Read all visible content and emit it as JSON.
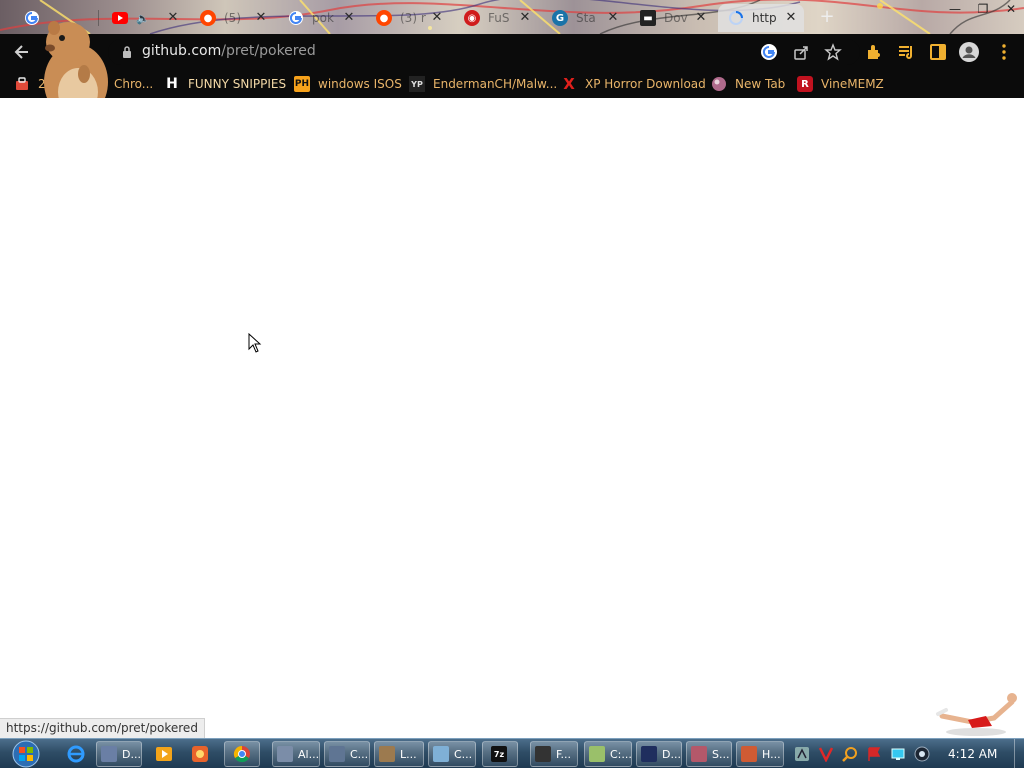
{
  "browser": {
    "tabs": [
      {
        "title": "",
        "favicon": "google-icon"
      },
      {
        "title": "",
        "favicon": "youtube-icon"
      },
      {
        "title": "(5)",
        "favicon": "reddit-icon"
      },
      {
        "title": "pok",
        "favicon": "google-icon"
      },
      {
        "title": "(3) r",
        "favicon": "reddit-icon"
      },
      {
        "title": "FuS",
        "favicon": "site-icon"
      },
      {
        "title": "Sta",
        "favicon": "site-icon"
      },
      {
        "title": "Dov",
        "favicon": "site-icon"
      },
      {
        "title": "http",
        "favicon": "loading-icon",
        "active": true
      }
    ],
    "url": {
      "host": "github.com",
      "path": "/pret/pokered"
    },
    "bookmarks": [
      {
        "label": "2p",
        "icon": "bag-icon"
      },
      {
        "label": "Chro...",
        "icon": "folder-icon"
      },
      {
        "label": "FUNNY SNIPPIES",
        "icon": "h-icon",
        "glyph": "H"
      },
      {
        "label": "windows ISOS",
        "icon": "ph-icon",
        "glyph": "PH"
      },
      {
        "label": "EndermanCH/Malw...",
        "icon": "yp-icon",
        "glyph": "YP"
      },
      {
        "label": "XP Horror Download",
        "icon": "x-icon",
        "glyph": "X"
      },
      {
        "label": "New Tab",
        "icon": "orb-icon"
      },
      {
        "label": "VineMEMZ",
        "icon": "r-icon",
        "glyph": "R"
      }
    ],
    "status_url": "https://github.com/pret/pokered"
  },
  "taskbar": {
    "buttons": [
      {
        "label": "D..."
      },
      {
        "label": "Al..."
      },
      {
        "label": "C..."
      },
      {
        "label": "L..."
      },
      {
        "label": "C..."
      },
      {
        "label": ""
      },
      {
        "label": "F..."
      },
      {
        "label": "C:..."
      },
      {
        "label": "D..."
      },
      {
        "label": "S..."
      },
      {
        "label": "H..."
      }
    ],
    "clock": "4:12 AM"
  }
}
